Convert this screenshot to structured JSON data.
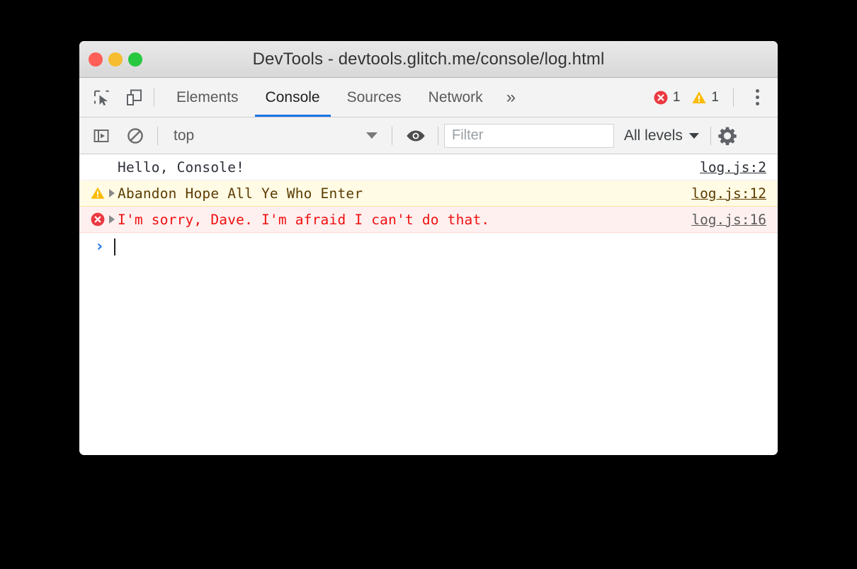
{
  "window": {
    "title": "DevTools - devtools.glitch.me/console/log.html",
    "traffic_lights": [
      {
        "name": "close",
        "color": "#ff5f57"
      },
      {
        "name": "minimize",
        "color": "#f5bd2f"
      },
      {
        "name": "maximize",
        "color": "#28c840"
      }
    ]
  },
  "tabbar": {
    "icons": [
      {
        "name": "inspect-element-icon"
      },
      {
        "name": "device-toolbar-icon"
      }
    ],
    "tabs": [
      {
        "label": "Elements",
        "active": false
      },
      {
        "label": "Console",
        "active": true
      },
      {
        "label": "Sources",
        "active": false
      },
      {
        "label": "Network",
        "active": false
      }
    ],
    "more_label": "»",
    "error_count": "1",
    "warning_count": "1",
    "accent_color": "#1a73e8",
    "error_color": "#eb3941",
    "warning_color": "#fabb05"
  },
  "console_toolbar": {
    "sidebar_toggle_icon": "show-console-sidebar-icon",
    "clear_icon": "clear-console-icon",
    "context": "top",
    "eye_icon": "live-expression-eye-icon",
    "filter_placeholder": "Filter",
    "filter_value": "",
    "levels_label": "All levels",
    "settings_icon": "gear-icon"
  },
  "console_messages": [
    {
      "level": "log",
      "icon": "",
      "expandable": false,
      "text": "Hello, Console!",
      "source": "log.js:2"
    },
    {
      "level": "warning",
      "icon": "warning-triangle-icon",
      "expandable": true,
      "text": "Abandon Hope All Ye Who Enter",
      "source": "log.js:12"
    },
    {
      "level": "error",
      "icon": "error-circle-icon",
      "expandable": true,
      "text": "I'm sorry, Dave. I'm afraid I can't do that.",
      "source": "log.js:16"
    }
  ],
  "prompt": {
    "chevron": "›",
    "value": ""
  }
}
